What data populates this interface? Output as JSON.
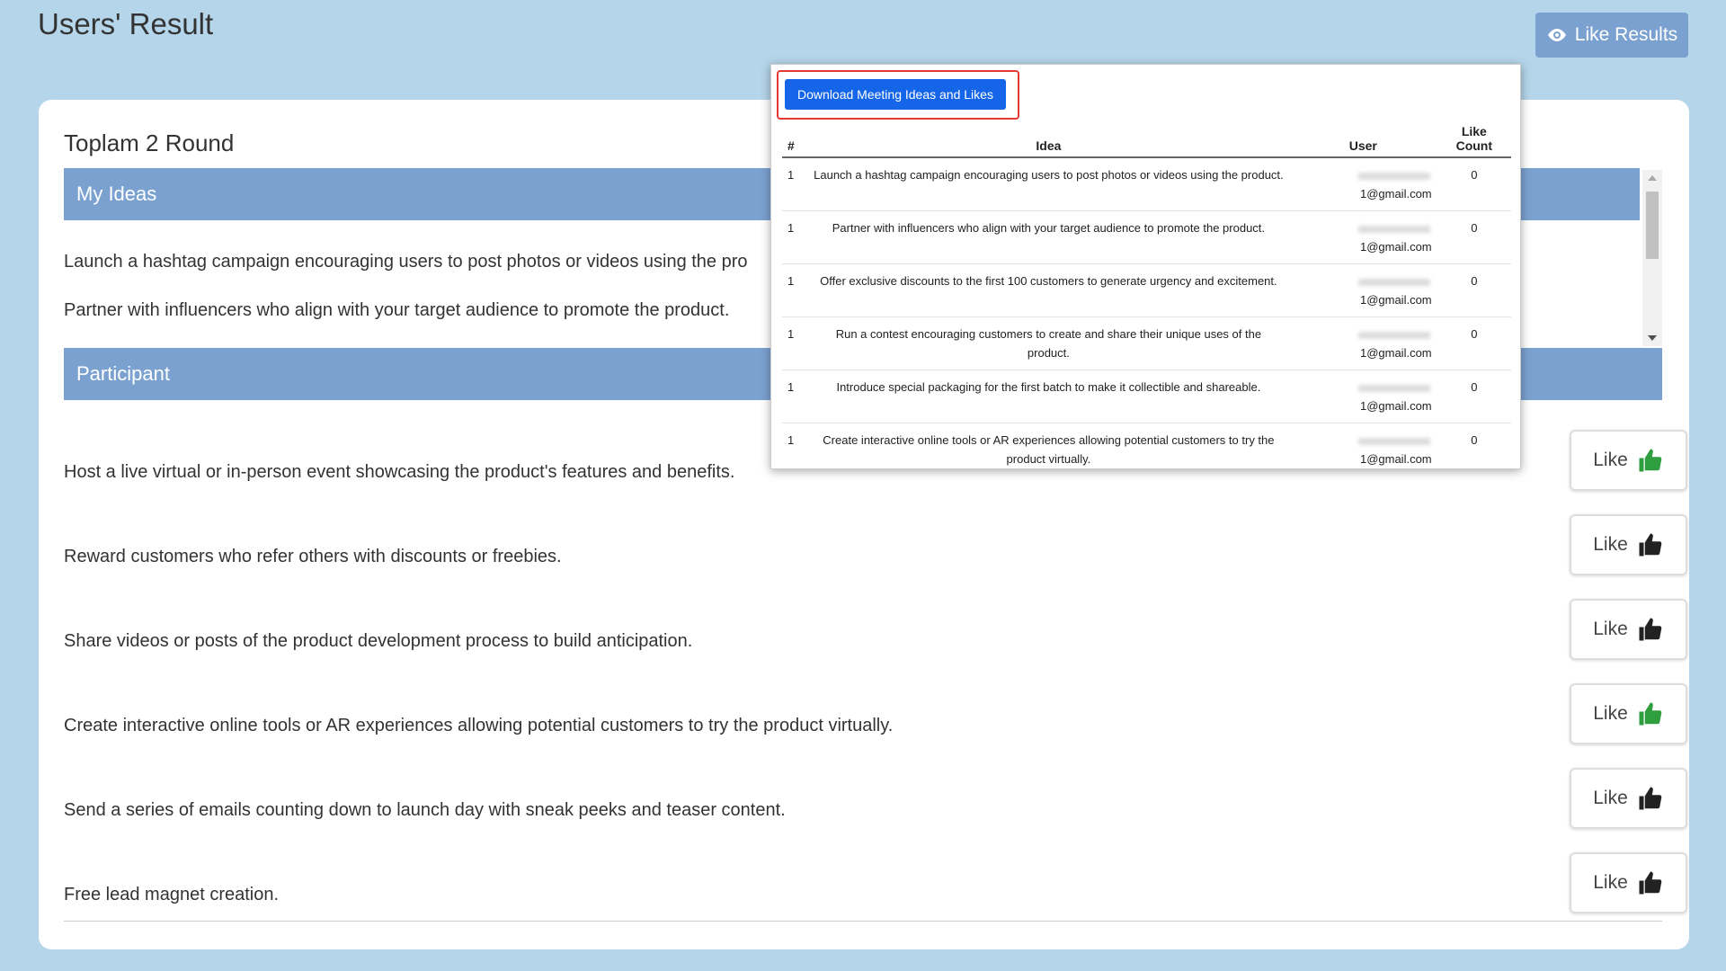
{
  "page": {
    "title": "Users' Result",
    "like_results_button": "Like Results",
    "accent_color": "#7aa1d0"
  },
  "card": {
    "round_title": "Toplam 2 Round",
    "my_ideas_header": "My Ideas",
    "participant_header": "Participant",
    "my_ideas": [
      "Launch a hashtag campaign encouraging users to post photos or videos using the pro",
      "Partner with influencers who align with your target audience to promote the product."
    ],
    "participant_ideas": [
      {
        "text": "Host a live virtual or in-person event showcasing the product's features and benefits.",
        "like_label": "Like",
        "liked": true
      },
      {
        "text": "Reward customers who refer others with discounts or freebies.",
        "like_label": "Like",
        "liked": false
      },
      {
        "text": "Share videos or posts of the product development process to build anticipation.",
        "like_label": "Like",
        "liked": false
      },
      {
        "text": "Create interactive online tools or AR experiences allowing potential customers to try the product virtually.",
        "like_label": "Like",
        "liked": true
      },
      {
        "text": "Send a series of emails counting down to launch day with sneak peeks and teaser content.",
        "like_label": "Like",
        "liked": false
      },
      {
        "text": "Free lead magnet creation.",
        "like_label": "Like",
        "liked": false
      }
    ]
  },
  "popup": {
    "download_button": "Download Meeting Ideas and Likes",
    "columns": [
      "#",
      "Idea",
      "User",
      "Like Count"
    ],
    "rows": [
      {
        "num": "1",
        "idea": "Launch a hashtag campaign encouraging users to post photos or videos using the product.",
        "user": "1@gmail.com",
        "likes": "0"
      },
      {
        "num": "1",
        "idea": "Partner with influencers who align with your target audience to promote the product.",
        "user": "1@gmail.com",
        "likes": "0"
      },
      {
        "num": "1",
        "idea": "Offer exclusive discounts to the first 100 customers to generate urgency and excitement.",
        "user": "1@gmail.com",
        "likes": "0"
      },
      {
        "num": "1",
        "idea": "Run a contest encouraging customers to create and share their unique uses of the product.",
        "user": "1@gmail.com",
        "likes": "0"
      },
      {
        "num": "1",
        "idea": "Introduce special packaging for the first batch to make it collectible and shareable.",
        "user": "1@gmail.com",
        "likes": "0"
      },
      {
        "num": "1",
        "idea": "Create interactive online tools or AR experiences allowing potential customers to try the product virtually.",
        "user": "1@gmail.com",
        "likes": "0"
      }
    ]
  }
}
